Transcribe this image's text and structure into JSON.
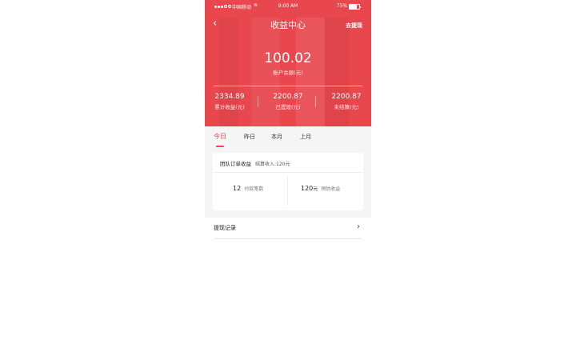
{
  "status_bar": {
    "carrier": "中国移动",
    "time": "9:00 AM",
    "battery": "75%",
    "battery_level": 0.75
  },
  "header": {
    "back_icon": "chevron-left-icon",
    "title": "收益中心",
    "action": "去提现"
  },
  "balance": {
    "amount": "100.02",
    "label": "账户余额(元)"
  },
  "stats": [
    {
      "value": "2334.89",
      "label": "累计收益(元)"
    },
    {
      "value": "2200.87",
      "label": "已提现(元)"
    },
    {
      "value": "2200.87",
      "label": "未结算(元)"
    }
  ],
  "tabs": [
    {
      "label": "今日",
      "active": true
    },
    {
      "label": "昨日",
      "active": false
    },
    {
      "label": "本月",
      "active": false
    },
    {
      "label": "上月",
      "active": false
    }
  ],
  "card": {
    "title": "团队订单收益",
    "subtitle": "结算收入:120元",
    "left": {
      "value": "12",
      "label": "付款笔数"
    },
    "right": {
      "value": "120",
      "unit": "元",
      "label": "预估收益"
    }
  },
  "record": {
    "label": "提现记录",
    "icon": "chevron-right-icon"
  },
  "colors": {
    "accent": "#e8474e",
    "background": "#f5f5f5"
  }
}
